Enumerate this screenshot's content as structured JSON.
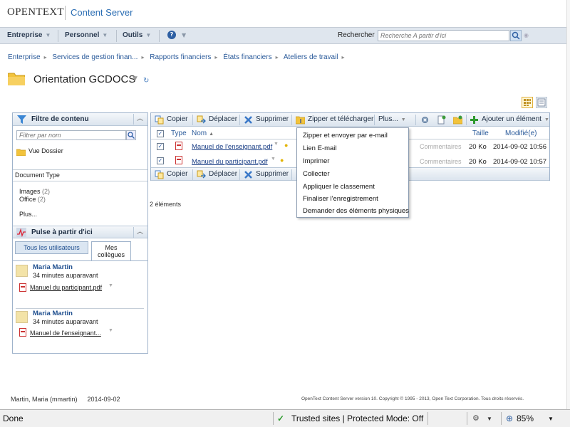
{
  "header": {
    "logo_text": "OPENTEXT",
    "product": "Content Server"
  },
  "navbar": {
    "items": [
      "Entreprise",
      "Personnel",
      "Outils"
    ],
    "help_icon": "help-icon",
    "search_label": "Rechercher",
    "search_placeholder": "Recherche A partir d'ici"
  },
  "breadcrumb": [
    "Enterprise",
    "Services de gestion finan...",
    "Rapports financiers",
    "États financiers",
    "Ateliers de travail"
  ],
  "page": {
    "title": "Orientation GCDOCS"
  },
  "filter_panel": {
    "title": "Filtre de contenu",
    "filter_placeholder": "Filtrer par nom",
    "folder_view": "Vue Dossier",
    "doc_type_label": "Document Type",
    "types": [
      {
        "name": "Images",
        "count": "(2)"
      },
      {
        "name": "Office",
        "count": "(2)"
      }
    ],
    "more": "Plus..."
  },
  "pulse_panel": {
    "title": "Pulse à partir d'ici",
    "tab_all": "Tous les utilisateurs",
    "tab_mine_line1": "Mes",
    "tab_mine_line2": "collègues",
    "entries": [
      {
        "user": "Maria Martin",
        "time": "34 minutes auparavant",
        "doc": "Manuel du participant.pdf"
      },
      {
        "user": "Maria Martin",
        "time": "34 minutes auparavant",
        "doc": "Manuel de l'enseignant..."
      }
    ]
  },
  "toolbar": {
    "copy": "Copier",
    "move": "Déplacer",
    "delete": "Supprimer",
    "zip": "Zipper et télécharger",
    "more": "Plus...",
    "add_item": "Ajouter un élément"
  },
  "table": {
    "col_type": "Type",
    "col_name": "Nom",
    "col_size": "Taille",
    "col_modified": "Modifié(e)",
    "rows": [
      {
        "name": "Manuel de l'enseignant.pdf",
        "comments": "Commentaires",
        "size": "20 Ko",
        "modified": "2014-09-02 10:56"
      },
      {
        "name": "Manuel du participant.pdf",
        "comments": "Commentaires",
        "size": "20 Ko",
        "modified": "2014-09-02 10:57"
      }
    ],
    "item_count": "2 éléments"
  },
  "more_menu": {
    "items": [
      "Zipper et envoyer par e-mail",
      "Lien E-mail",
      "Imprimer",
      "Collecter",
      "Appliquer le classement",
      "Finaliser l'enregistrement",
      "Demander des éléments physiques"
    ]
  },
  "footer": {
    "user": "Martin, Maria (mmartin)",
    "date": "2014-09-02",
    "copyright": "OpenText Content Server version 10. Copyright © 1995 - 2013, Open Text Corporation. Tous droits réservés."
  },
  "statusbar": {
    "status": "Done",
    "zone": "Trusted sites | Protected Mode: Off",
    "zoom": "85%"
  },
  "colors": {
    "accent": "#2a6db3",
    "navbar": "#dfe6ee",
    "panel_border": "#9fb3cb"
  }
}
